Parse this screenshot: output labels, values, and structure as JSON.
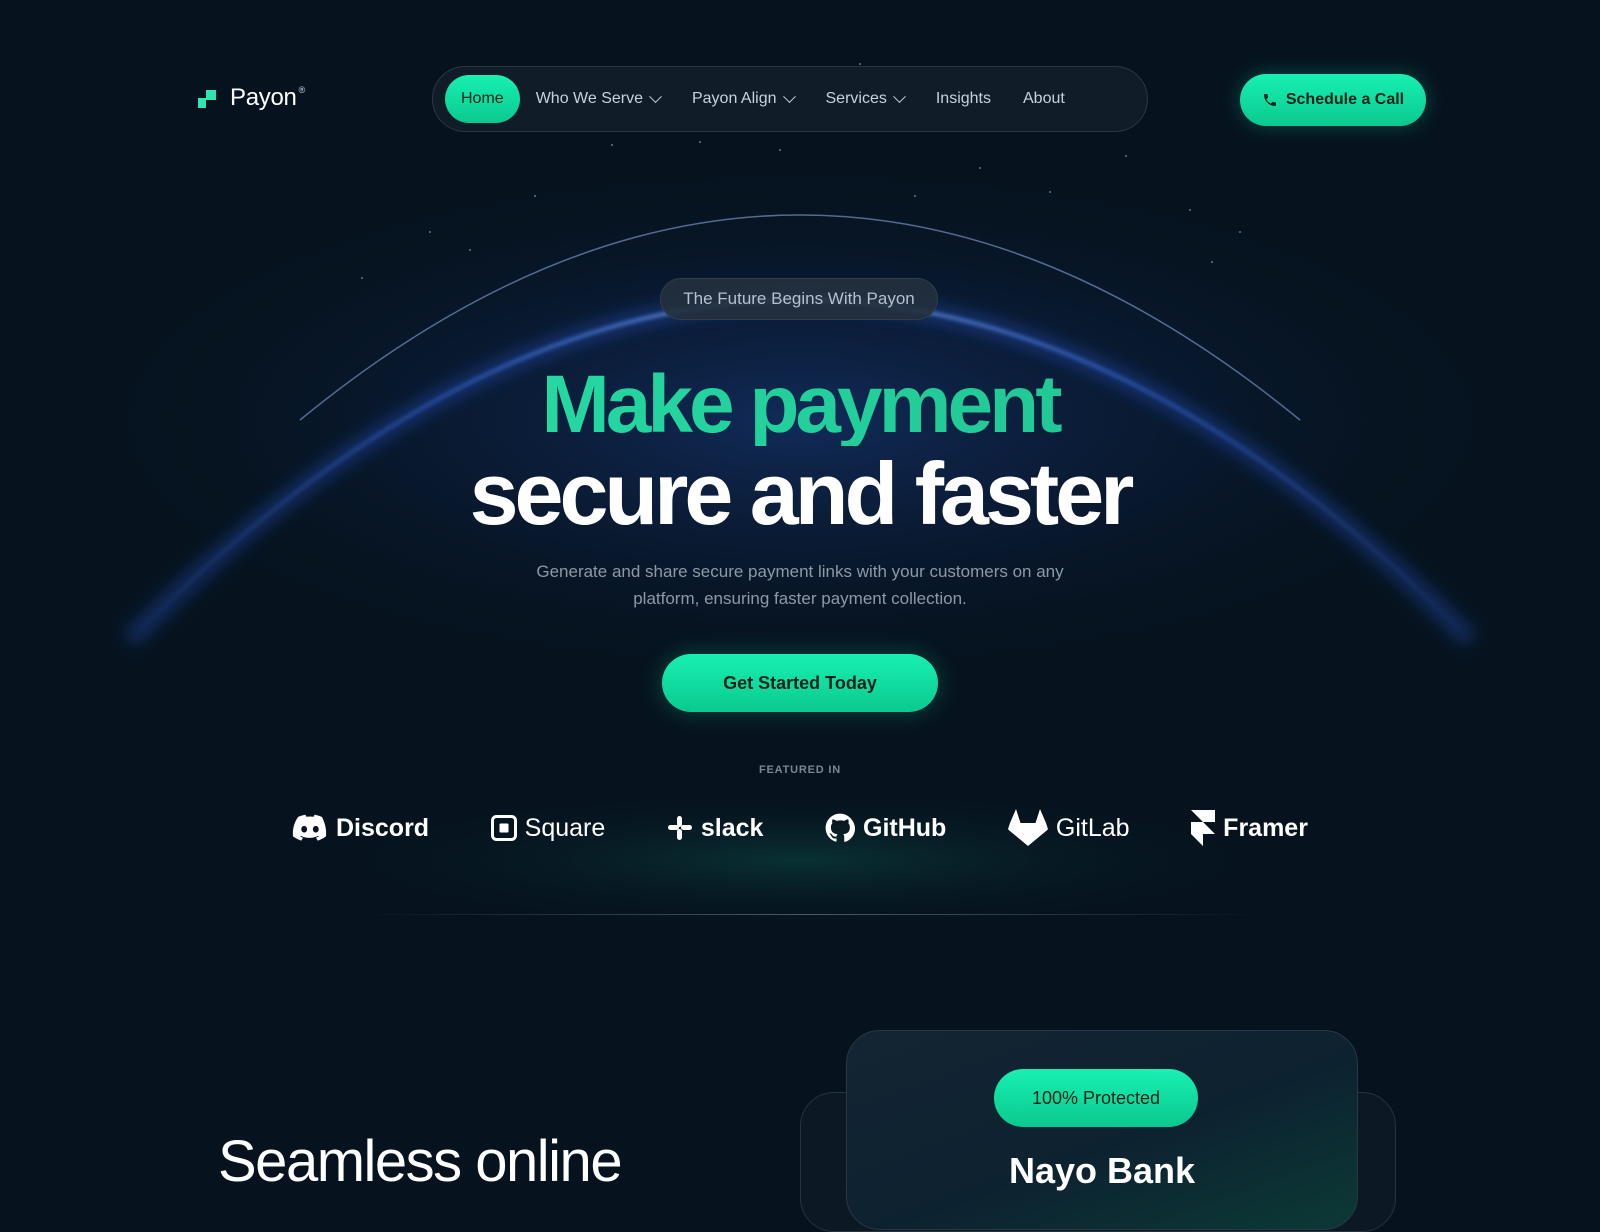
{
  "brand": {
    "name": "Payon",
    "reg": "®"
  },
  "nav": {
    "items": [
      {
        "label": "Home",
        "active": true,
        "dropdown": false
      },
      {
        "label": "Who We Serve",
        "active": false,
        "dropdown": true
      },
      {
        "label": "Payon Align",
        "active": false,
        "dropdown": true
      },
      {
        "label": "Services",
        "active": false,
        "dropdown": true
      },
      {
        "label": "Insights",
        "active": false,
        "dropdown": false
      },
      {
        "label": "About",
        "active": false,
        "dropdown": false
      }
    ]
  },
  "header_cta": {
    "label": "Schedule a Call",
    "icon": "phone-icon"
  },
  "hero": {
    "badge": "The Future Begins With Payon",
    "headline_line1": "Make payment",
    "headline_line2": "secure and faster",
    "subtitle": "Generate and share secure payment links with your customers on any platform, ensuring faster payment collection.",
    "cta": "Get Started Today"
  },
  "featured": {
    "heading": "FEATURED IN",
    "brands": [
      "Discord",
      "Square",
      "slack",
      "GitHub",
      "GitLab",
      "Framer"
    ]
  },
  "section2": {
    "title": "Seamless online",
    "card_badge": "100% Protected",
    "card_title": "Nayo Bank"
  },
  "colors": {
    "accent": "#18f0b2",
    "background": "#06131f",
    "glow": "#3d7bff"
  }
}
